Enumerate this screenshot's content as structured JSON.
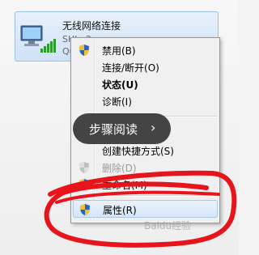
{
  "connection": {
    "name": "无线网络连接",
    "status_line1": "SHI...2",
    "status_line2": "Qu",
    "icon": "wireless-network-icon"
  },
  "context_menu": {
    "items": [
      {
        "label": "禁用(B)",
        "icon": "uac-shield-icon"
      },
      {
        "label": "连接/断开(O)"
      },
      {
        "label": "状态(U)",
        "bold": true
      },
      {
        "label": "诊断(I)"
      },
      {
        "label": "创建快捷方式(S)"
      },
      {
        "label": "删除(D)",
        "icon": "uac-shield-icon",
        "disabled": true
      },
      {
        "label": "重命名(M)",
        "icon": "uac-shield-icon"
      },
      {
        "label": "属性(R)",
        "icon": "uac-shield-icon",
        "highlighted": true
      }
    ]
  },
  "reader_overlay": {
    "label": "步骤阅读",
    "chevron": "›"
  },
  "annotation_color": "#e8141b",
  "watermark": "Baidu经验"
}
